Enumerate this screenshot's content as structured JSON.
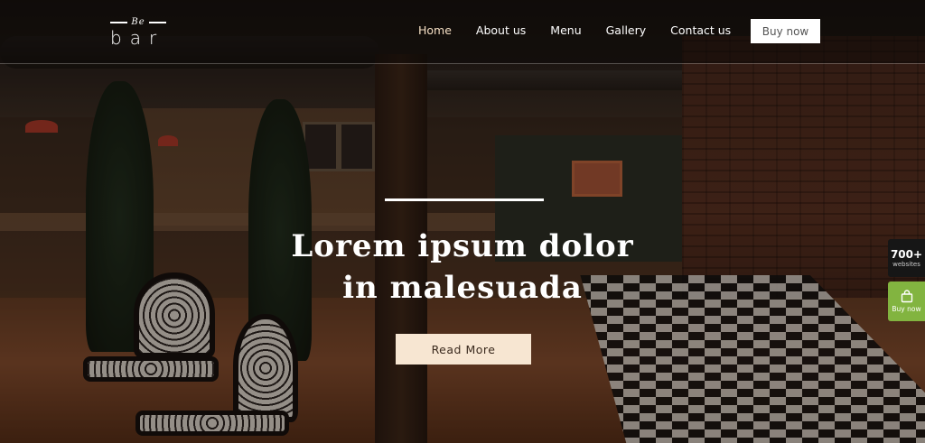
{
  "logo": {
    "top_text": "Be",
    "main_text": "bar"
  },
  "nav": {
    "items": [
      {
        "label": "Home",
        "active": true
      },
      {
        "label": "About us"
      },
      {
        "label": "Menu"
      },
      {
        "label": "Gallery"
      },
      {
        "label": "Contact us"
      }
    ],
    "buy_label": "Buy now"
  },
  "hero": {
    "title_line1": "Lorem ipsum dolor",
    "title_line2": "in malesuada",
    "button_label": "Read More"
  },
  "side_widgets": {
    "count_number": "700+",
    "count_label": "websites",
    "buy_label": "Buy now",
    "buy_icon": "shopping-bag-icon"
  },
  "colors": {
    "accent_button": "#f7e6d2",
    "nav_active": "#f5dfc4",
    "side_buy_green": "#82b440"
  }
}
